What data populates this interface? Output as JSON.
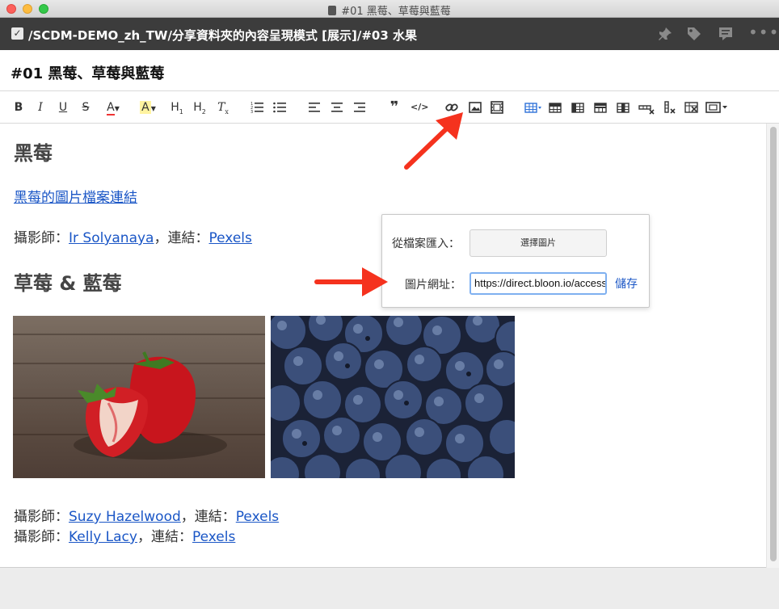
{
  "window": {
    "title": "#01 黑莓、草莓與藍莓"
  },
  "header": {
    "path": "/SCDM-DEMO_zh_TW/分享資料夾的內容呈現模式 [展示]/#03 水果",
    "icons": [
      "pin-icon",
      "tag-icon",
      "comment-icon",
      "more-icon"
    ]
  },
  "note": {
    "title": "#01 黑莓、草莓與藍莓"
  },
  "toolbar": {
    "bold": "B",
    "italic": "I",
    "underline": "U",
    "strike": "S",
    "font_color": "A",
    "highlight": "A",
    "h1": "H",
    "h2": "H",
    "clear_format": "T",
    "icons": [
      "ordered-list-icon",
      "bullet-list-icon",
      "align-left-icon",
      "align-center-icon",
      "align-right-icon",
      "quote-icon",
      "code-icon",
      "link-icon",
      "image-icon",
      "video-icon",
      "table-icon",
      "table-row-icon",
      "table-col-icon",
      "table-header-icon",
      "table-merge-icon",
      "delete-row-icon",
      "delete-col-icon",
      "delete-table-icon",
      "embed-icon"
    ]
  },
  "content": {
    "h_blackberry": "黑莓",
    "blackberry_link": "黑莓的圖片檔案連結",
    "credit1": {
      "prefix": "攝影師：",
      "name": "Ir Solyanaya",
      "mid": "，連結：",
      "site": "Pexels"
    },
    "h_straw_blue": "草莓 & 藍莓",
    "credit2": {
      "prefix": "攝影師：",
      "name": "Suzy Hazelwood",
      "mid": "，連結：",
      "site": "Pexels"
    },
    "credit3": {
      "prefix": "攝影師：",
      "name": "Kelly Lacy",
      "mid": "，連結：",
      "site": "Pexels"
    }
  },
  "image_popover": {
    "file_label": "從檔案匯入：",
    "file_button": "選擇圖片",
    "url_label": "圖片網址：",
    "url_value": "https://direct.bloon.io/access",
    "save": "儲存"
  },
  "colors": {
    "link": "#1a56c6",
    "header_bg": "#3c3c3c",
    "arrow": "#f5321e",
    "input_focus": "#7fb0f0"
  }
}
